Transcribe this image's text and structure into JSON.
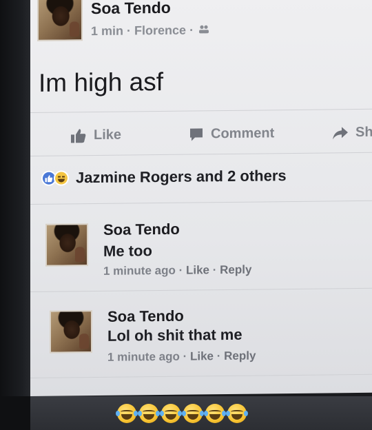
{
  "post": {
    "author": "Soa Tendo",
    "time": "1 min",
    "location": "Florence",
    "privacy_icon": "friends-icon",
    "text": "Im high asf"
  },
  "actions": {
    "like": "Like",
    "comment": "Comment",
    "share": "Sh"
  },
  "reactions": {
    "summary": "Jazmine Rogers and 2 others"
  },
  "comments": [
    {
      "author": "Soa Tendo",
      "text": "Me too",
      "time": "1 minute ago",
      "like": "Like",
      "reply": "Reply"
    },
    {
      "author": "Soa Tendo",
      "text": "Lol oh shit that me",
      "time": "1 minute ago",
      "like": "Like",
      "reply": "Reply"
    }
  ],
  "caption_emojis": [
    "😂",
    "😂",
    "😂",
    "😂",
    "😂",
    "😂"
  ],
  "colors": {
    "like_blue": "#4a78d6",
    "haha_yellow": "#f4c542",
    "muted_text": "#8a8d94"
  }
}
